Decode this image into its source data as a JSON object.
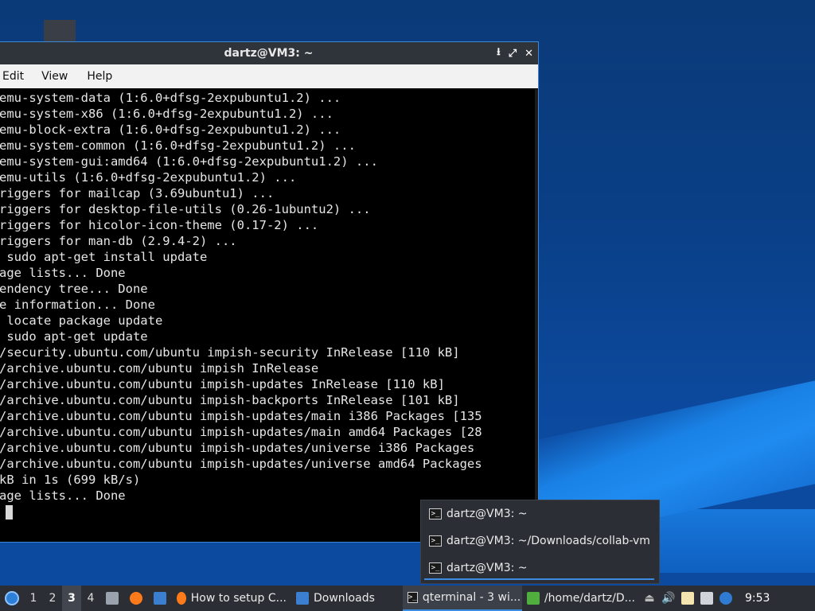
{
  "terminal": {
    "title": "dartz@VM3: ~",
    "controls": [
      "⭳",
      "⤢",
      "✕"
    ],
    "menu": [
      "Edit",
      "View",
      "Help"
    ],
    "lines": [
      "emu-system-data (1:6.0+dfsg-2expubuntu1.2) ...",
      "emu-system-x86 (1:6.0+dfsg-2expubuntu1.2) ...",
      "emu-block-extra (1:6.0+dfsg-2expubuntu1.2) ...",
      "emu-system-common (1:6.0+dfsg-2expubuntu1.2) ...",
      "emu-system-gui:amd64 (1:6.0+dfsg-2expubuntu1.2) ...",
      "emu-utils (1:6.0+dfsg-2expubuntu1.2) ...",
      "riggers for mailcap (3.69ubuntu1) ...",
      "riggers for desktop-file-utils (0.26-1ubuntu2) ...",
      "riggers for hicolor-icon-theme (0.17-2) ...",
      "riggers for man-db (2.9.4-2) ...",
      " sudo apt-get install update",
      "age lists... Done",
      "endency tree... Done",
      "e information... Done",
      " locate package update",
      " sudo apt-get update",
      "/security.ubuntu.com/ubuntu impish-security InRelease [110 kB]",
      "/archive.ubuntu.com/ubuntu impish InRelease",
      "/archive.ubuntu.com/ubuntu impish-updates InRelease [110 kB]",
      "/archive.ubuntu.com/ubuntu impish-backports InRelease [101 kB]",
      "/archive.ubuntu.com/ubuntu impish-updates/main i386 Packages [135",
      "/archive.ubuntu.com/ubuntu impish-updates/main amd64 Packages [28",
      "/archive.ubuntu.com/ubuntu impish-updates/universe i386 Packages",
      "/archive.ubuntu.com/ubuntu impish-updates/universe amd64 Packages",
      "kB in 1s (699 kB/s)",
      "age lists... Done",
      ""
    ]
  },
  "popup": {
    "items": [
      "dartz@VM3: ~",
      "dartz@VM3: ~/Downloads/collab-vm",
      "dartz@VM3: ~"
    ]
  },
  "taskbar": {
    "workspaces": [
      "1",
      "2",
      "3",
      "4"
    ],
    "tasks": {
      "browser": "How to setup C...",
      "downloads": "Downloads",
      "qterminal": "qterminal - 3 wi...",
      "filemanager": "/home/dartz/D..."
    },
    "clock": "9:53"
  },
  "colors": {
    "accent": "#3b8be0",
    "taskbar": "#2b2e34",
    "titlebar": "#2f343b"
  }
}
